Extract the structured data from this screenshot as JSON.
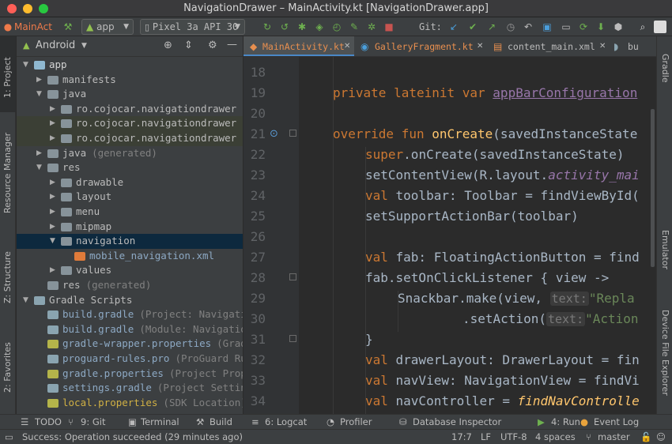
{
  "window": {
    "title": "NavigationDrawer – MainActivity.kt [NavigationDrawer.app]"
  },
  "toolbar": {
    "project_label": "MainAct",
    "module_combo": "app",
    "device_combo": "Pixel 3a API 30",
    "git_label": "Git:"
  },
  "left_strip": {
    "project": "1: Project",
    "resource_manager": "Resource Manager",
    "structure": "Z: Structure",
    "favorites": "2: Favorites"
  },
  "right_strip": {
    "gradle": "Gradle",
    "emulator": "Emulator",
    "device_explorer": "Device File Explorer"
  },
  "project_panel": {
    "view_selector": "Android",
    "tree": [
      {
        "label": "app",
        "hint": ""
      },
      {
        "label": "manifests",
        "hint": ""
      },
      {
        "label": "java",
        "hint": ""
      },
      {
        "label": "ro.cojocar.navigationdrawer",
        "hint": ""
      },
      {
        "label": "ro.cojocar.navigationdrawer",
        "hint": "("
      },
      {
        "label": "ro.cojocar.navigationdrawer",
        "hint": "("
      },
      {
        "label": "java",
        "hint": "(generated)"
      },
      {
        "label": "res",
        "hint": ""
      },
      {
        "label": "drawable",
        "hint": ""
      },
      {
        "label": "layout",
        "hint": ""
      },
      {
        "label": "menu",
        "hint": ""
      },
      {
        "label": "mipmap",
        "hint": ""
      },
      {
        "label": "navigation",
        "hint": ""
      },
      {
        "label": "mobile_navigation.xml",
        "hint": ""
      },
      {
        "label": "values",
        "hint": ""
      },
      {
        "label": "res",
        "hint": "(generated)"
      },
      {
        "label": "Gradle Scripts",
        "hint": ""
      },
      {
        "label": "build.gradle",
        "hint": "(Project: Navigati"
      },
      {
        "label": "build.gradle",
        "hint": "(Module: Navigation"
      },
      {
        "label": "gradle-wrapper.properties",
        "hint": "(Grad"
      },
      {
        "label": "proguard-rules.pro",
        "hint": "(ProGuard Ru"
      },
      {
        "label": "gradle.properties",
        "hint": "(Project Prope"
      },
      {
        "label": "settings.gradle",
        "hint": "(Project Settin"
      },
      {
        "label": "local.properties",
        "hint": "(SDK Location)"
      }
    ]
  },
  "editor": {
    "tabs": [
      {
        "label": "MainActivity.kt"
      },
      {
        "label": "GalleryFragment.kt"
      },
      {
        "label": "content_main.xml"
      },
      {
        "label": "bu"
      }
    ],
    "lines": [
      {
        "n": "18"
      },
      {
        "n": "19"
      },
      {
        "n": "20"
      },
      {
        "n": "21"
      },
      {
        "n": "22"
      },
      {
        "n": "23"
      },
      {
        "n": "24"
      },
      {
        "n": "25"
      },
      {
        "n": "26"
      },
      {
        "n": "27"
      },
      {
        "n": "28"
      },
      {
        "n": "29"
      },
      {
        "n": "30"
      },
      {
        "n": "31"
      },
      {
        "n": "32"
      },
      {
        "n": "33"
      },
      {
        "n": "34"
      }
    ],
    "code": {
      "l19_kw": "private lateinit var ",
      "l19_prop": "appBarConfiguration",
      "l21_kw": "override fun ",
      "l21_fn": "onCreate",
      "l21_rest": "(savedInstanceState",
      "l22_kw": "super",
      "l22_rest": ".onCreate(savedInstanceState)",
      "l23_a": "setContentView(R.layout.",
      "l23_it": "activity_mai",
      "l24_kw": "val ",
      "l24_rest": "toolbar: Toolbar = findViewById(",
      "l25": "setSupportActionBar(toolbar)",
      "l27_kw": "val ",
      "l27_rest": "fab: FloatingActionButton = find",
      "l28": "fab.setOnClickListener { view ->",
      "l29_a": "Snackbar.make(view, ",
      "l29_hint": "text:",
      "l29_str": "\"Repla",
      "l30_a": ".setAction(",
      "l30_hint": "text:",
      "l30_str": "\"Action",
      "l31": "}",
      "l32_kw": "val ",
      "l32_rest": "drawerLayout: DrawerLayout = fin",
      "l33_kw": "val ",
      "l33_rest": "navView: NavigationView = findVi",
      "l34_kw": "val ",
      "l34_rest": "navController = ",
      "l34_fn": "findNavControlle"
    }
  },
  "bottom_bar": {
    "todo": "TODO",
    "git": "9: Git",
    "terminal": "Terminal",
    "build": "Build",
    "logcat": "6: Logcat",
    "profiler": "Profiler",
    "db": "Database Inspector",
    "run": "4: Run",
    "event_log": "Event Log"
  },
  "status": {
    "message": "Success: Operation succeeded (29 minutes ago)",
    "position": "17:7",
    "line_sep": "LF",
    "encoding": "UTF-8",
    "indent": "4 spaces",
    "branch": "master"
  }
}
